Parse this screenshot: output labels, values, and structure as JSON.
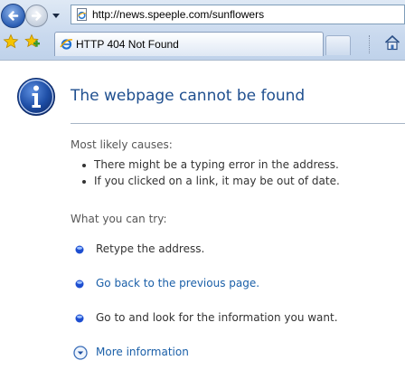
{
  "browser": {
    "address": "http://news.speeple.com/sunflowers",
    "tab_title": "HTTP 404 Not Found"
  },
  "page": {
    "title": "The webpage cannot be found",
    "causes_heading": "Most likely causes:",
    "causes": [
      "There might be a typing error in the address.",
      "If you clicked on a link, it may be out of date."
    ],
    "try_heading": "What you can try:",
    "try_items": [
      "Retype the address.",
      "Go back to the previous page.",
      "Go to  and look for the information you want."
    ],
    "more_info": "More information"
  },
  "colors": {
    "title": "#1f4f8f",
    "link": "#1a5fa8",
    "divider": "#a7b5c6"
  },
  "icons": [
    "back-icon",
    "forward-icon",
    "page-icon",
    "favorites-star-icon",
    "add-favorite-icon",
    "ie-tab-icon",
    "home-icon",
    "info-icon",
    "bullet-icon",
    "expand-chevron-icon"
  ]
}
